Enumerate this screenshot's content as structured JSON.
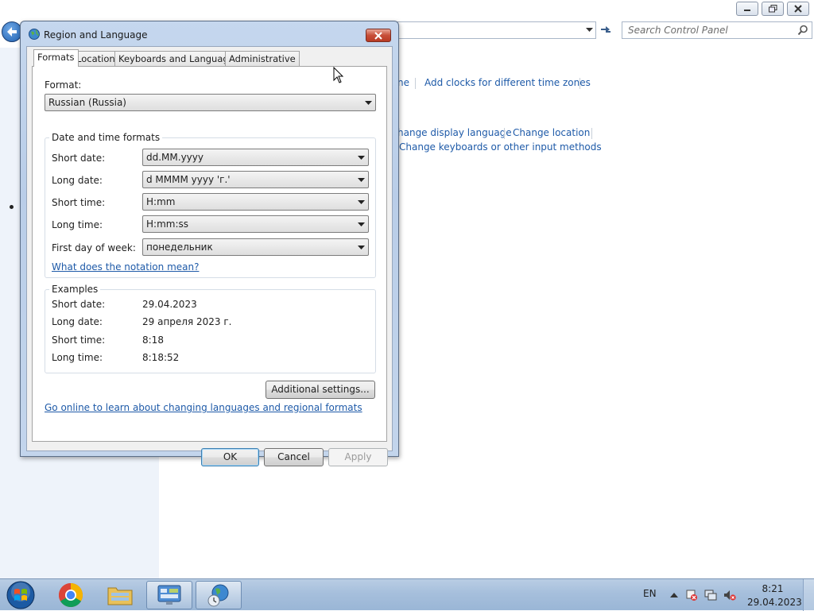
{
  "control_panel": {
    "search_placeholder": "Search Control Panel",
    "links": {
      "date_time_partial": "ne",
      "add_clocks": "Add clocks for different time zones",
      "change_display_language_partial": "hange display language",
      "change_location": "Change location",
      "change_keyboards": "Change keyboards or other input methods"
    }
  },
  "dialog": {
    "title": "Region and Language",
    "tabs": [
      "Formats",
      "Location",
      "Keyboards and Languages",
      "Administrative"
    ],
    "active_tab": "Formats",
    "format_label": "Format:",
    "format_value": "Russian (Russia)",
    "datetime_group": {
      "legend": "Date and time formats",
      "rows": [
        {
          "label": "Short date:",
          "value": "dd.MM.yyyy"
        },
        {
          "label": "Long date:",
          "value": "d MMMM yyyy 'г.'"
        },
        {
          "label": "Short time:",
          "value": "H:mm"
        },
        {
          "label": "Long time:",
          "value": "H:mm:ss"
        },
        {
          "label": "First day of week:",
          "value": "понедельник"
        }
      ],
      "notation_link": "What does the notation mean?"
    },
    "examples_group": {
      "legend": "Examples",
      "rows": [
        {
          "label": "Short date:",
          "value": "29.04.2023"
        },
        {
          "label": "Long date:",
          "value": "29 апреля 2023 г."
        },
        {
          "label": "Short time:",
          "value": "8:18"
        },
        {
          "label": "Long time:",
          "value": "8:18:52"
        }
      ]
    },
    "additional_settings_button": "Additional settings...",
    "online_link": "Go online to learn about changing languages and regional formats",
    "buttons": {
      "ok": "OK",
      "cancel": "Cancel",
      "apply": "Apply"
    }
  },
  "taskbar": {
    "language": "EN",
    "time": "8:21",
    "date": "29.04.2023",
    "pinned": [
      "start-orb-icon",
      "chrome-icon",
      "file-explorer-icon",
      "control-panel-icon",
      "region-language-icon"
    ]
  }
}
